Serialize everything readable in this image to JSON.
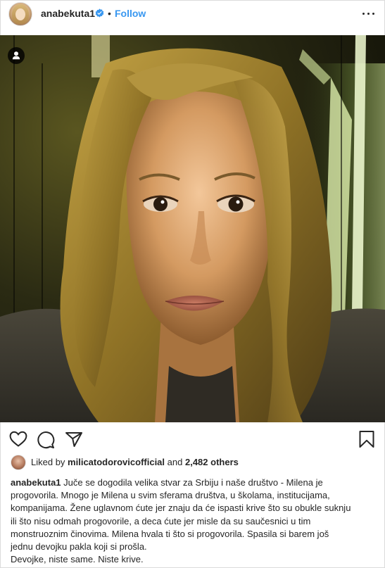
{
  "post": {
    "username": "anabekuta1",
    "follow_label": "Follow",
    "separator": "•"
  },
  "likes": {
    "prefix": "Liked by",
    "liker": "milicatodorovicofficial",
    "joiner": "and",
    "others": "2,482 others"
  },
  "caption": {
    "username": "anabekuta1",
    "lines": [
      "Juče se dogodila velika stvar za Srbiju i naše društvo - Milena je",
      "progovorila. Mnogo je Milena u svim sferama društva, u školama, institucijama,",
      "kompanijama. Žene uglavnom ćute jer znaju da će ispasti krive što su obukle suknju",
      "ili što nisu odmah progovorile, a deca ćute jer misle da su saučesnici u tim",
      "monstruoznim činovima. Milena hvala ti što si progovorila. Spasila si barem još",
      "jednu devojku pakla koji si prošla.",
      "Devojke, niste same. Niste krive."
    ]
  },
  "colors": {
    "link_blue": "#3897f0",
    "text": "#262626",
    "verified_blue": "#3897f0"
  },
  "icons": [
    "verified-badge-icon",
    "more-options-icon",
    "user-tag-icon",
    "heart-icon",
    "comment-icon",
    "share-icon",
    "bookmark-icon"
  ]
}
